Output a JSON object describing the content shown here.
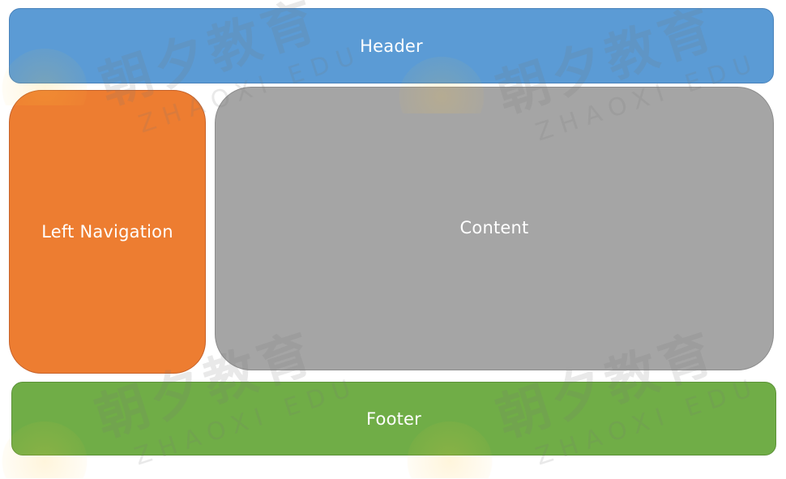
{
  "diagram": {
    "header_label": "Header",
    "left_nav_label": "Left Navigation",
    "content_label": "Content",
    "footer_label": "Footer"
  },
  "watermark": {
    "chinese_text": "朝夕教育",
    "english_text": "ZHAOXI EDU"
  },
  "colors": {
    "header": "#5b9bd5",
    "left_nav": "#ed7d31",
    "content": "#a5a5a5",
    "footer": "#70ad47"
  }
}
